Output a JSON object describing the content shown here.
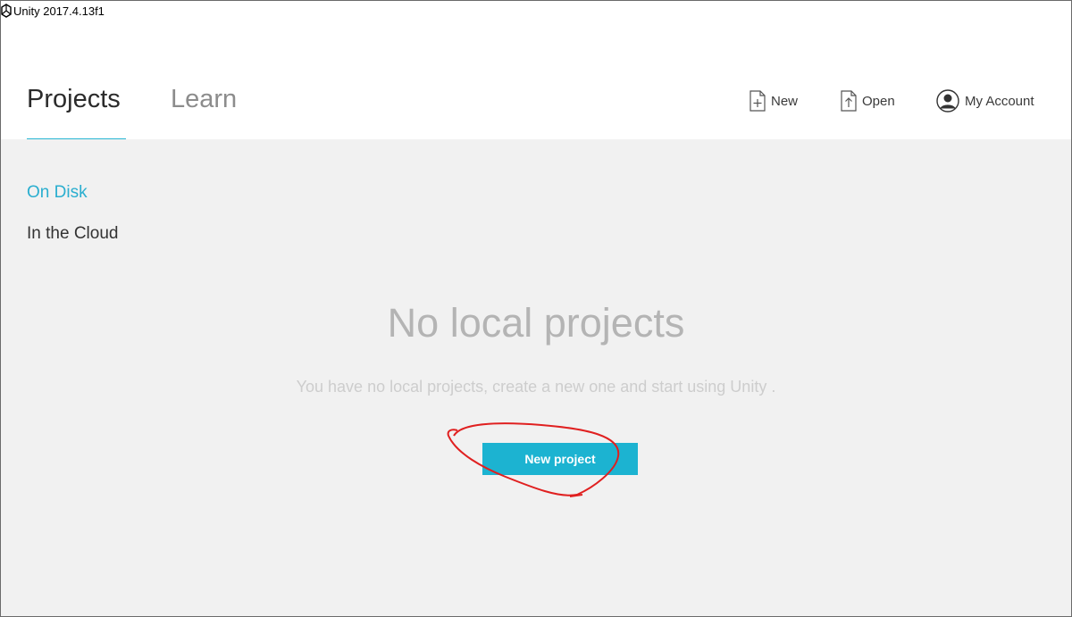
{
  "window": {
    "title": "Unity 2017.4.13f1"
  },
  "header": {
    "tabs": [
      {
        "label": "Projects",
        "active": true
      },
      {
        "label": "Learn",
        "active": false
      }
    ],
    "actions": [
      {
        "label": "New",
        "icon": "new-file-icon"
      },
      {
        "label": "Open",
        "icon": "open-file-icon"
      },
      {
        "label": "My Account",
        "icon": "account-icon"
      }
    ]
  },
  "sidebar": {
    "items": [
      {
        "label": "On Disk",
        "active": true
      },
      {
        "label": "In the Cloud",
        "active": false
      }
    ]
  },
  "main": {
    "empty_title": "No local projects",
    "empty_description": "You have no local projects, create a new one and start using Unity .",
    "new_project_label": "New project"
  },
  "colors": {
    "accent": "#1cb3d1",
    "annotation": "#e02020"
  }
}
